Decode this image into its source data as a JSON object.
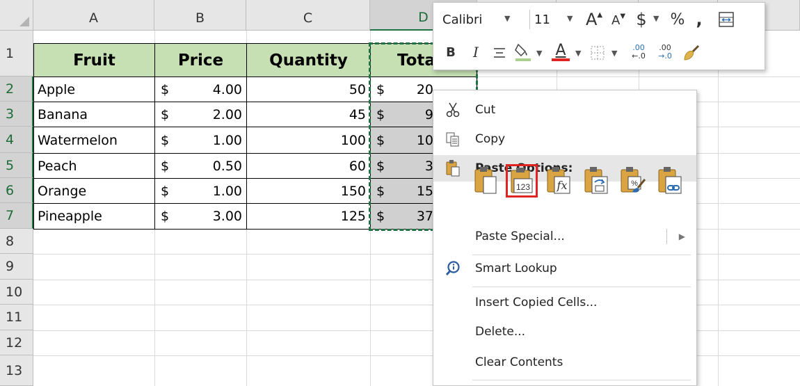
{
  "columns": [
    {
      "label": "A",
      "selected": false
    },
    {
      "label": "B",
      "selected": false
    },
    {
      "label": "C",
      "selected": false
    },
    {
      "label": "D",
      "selected": true
    }
  ],
  "rows": [
    "1",
    "2",
    "3",
    "4",
    "5",
    "6",
    "7",
    "8",
    "9",
    "10",
    "11",
    "12",
    "13"
  ],
  "table": {
    "headers": [
      "Fruit",
      "Price",
      "Quantity",
      "Tota"
    ],
    "currency_symbol": "$",
    "data": [
      {
        "fruit": "Apple",
        "price": "4.00",
        "qty": "50",
        "total": "20"
      },
      {
        "fruit": "Banana",
        "price": "2.00",
        "qty": "45",
        "total": "9"
      },
      {
        "fruit": "Watermelon",
        "price": "1.00",
        "qty": "100",
        "total": "10"
      },
      {
        "fruit": "Peach",
        "price": "0.50",
        "qty": "60",
        "total": "3"
      },
      {
        "fruit": "Orange",
        "price": "1.00",
        "qty": "150",
        "total": "15"
      },
      {
        "fruit": "Pineapple",
        "price": "3.00",
        "qty": "125",
        "total": "37"
      }
    ]
  },
  "mini_toolbar": {
    "font_name": "Calibri",
    "font_size": "11",
    "grow_font": "A",
    "shrink_font": "A",
    "currency": "$",
    "percent": "%",
    "comma": ",",
    "bold": "B",
    "italic": "I",
    "font_color_letter": "A",
    "inc_decimal_top": ".00",
    "inc_decimal_bottom": "←.0",
    "dec_decimal_top": ".00",
    "dec_decimal_bottom": "→.0"
  },
  "context_menu": {
    "cut": "Cut",
    "copy": "Copy",
    "paste_options": "Paste Options:",
    "paste_values_label": "123",
    "paste_formula_label": "fx",
    "paste_special": "Paste Special...",
    "smart_lookup": "Smart Lookup",
    "insert_copied_cells": "Insert Copied Cells...",
    "delete": "Delete...",
    "clear_contents": "Clear Contents"
  },
  "colors": {
    "header_fill": "#c6e0b4",
    "selection_green": "#217346",
    "highlight_red": "#e02424",
    "font_color_bar": "#e02424"
  }
}
